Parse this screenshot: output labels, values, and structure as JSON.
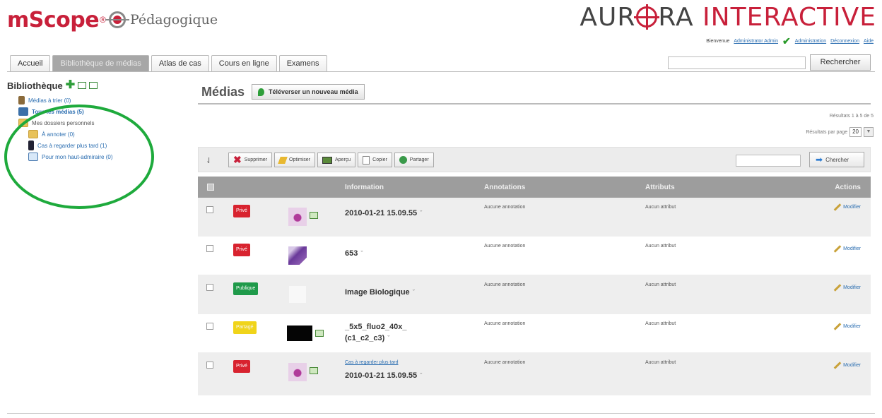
{
  "branding": {
    "mscope": "mScope",
    "reg": "®",
    "pedagogique": "Pédagogique",
    "aurora_a": "AUR",
    "aurora_b": "RA",
    "interactive": "INTERACTIVE",
    "accent_color": "#c8203a"
  },
  "userbar": {
    "welcome": "Bienvenue",
    "user_link": "Administrator Admin",
    "admin_link": "Administration",
    "logout_link": "Déconnexion",
    "help_link": "Aide"
  },
  "tabs": [
    {
      "label": "Accueil"
    },
    {
      "label": "Bibliothèque de médias",
      "active": true
    },
    {
      "label": "Atlas de cas"
    },
    {
      "label": "Cours en ligne"
    },
    {
      "label": "Examens"
    }
  ],
  "top_search": {
    "button": "Rechercher",
    "value": ""
  },
  "sidebar": {
    "title": "Bibliothèque",
    "items": [
      {
        "label": "Médias à trier (0)",
        "icon": "trash-icon"
      },
      {
        "label": "Tous les médias (5)",
        "icon": "book-icon"
      },
      {
        "label": "Mes dossiers personnels",
        "icon": "folder-icon"
      },
      {
        "label": "À annoter (0)",
        "icon": "folder-icon"
      },
      {
        "label": "Cas à regarder plus tard (1)",
        "icon": "person-icon"
      },
      {
        "label": "Pour mon haut-admiraire (0)",
        "icon": "presentation-icon"
      }
    ]
  },
  "main": {
    "title": "Médias",
    "upload_button": "Téléverser un nouveau média",
    "results": "Résultats 1 à 5 de 5",
    "per_page_label": "Résultats par page",
    "per_page_value": "20"
  },
  "toolbar": {
    "delete": "Supprimer",
    "optimize": "Optimiser",
    "preview": "Aperçu",
    "copy": "Copier",
    "share": "Partager",
    "search_button": "Chercher"
  },
  "table": {
    "headers": {
      "information": "Information",
      "annotations": "Annotations",
      "attributes": "Attributs",
      "actions": "Actions"
    },
    "rows": [
      {
        "badge": "Privé",
        "badge_type": "prive",
        "thumb": "pink",
        "info": "2010-01-21 15.09.55",
        "annotations": "Aucune annotation",
        "attributes": "Aucun attribut",
        "action": "Modifier"
      },
      {
        "badge": "Privé",
        "badge_type": "prive",
        "thumb": "purple",
        "info": "653",
        "annotations": "Aucune annotation",
        "attributes": "Aucun attribut",
        "action": "Modifier"
      },
      {
        "badge": "Publique",
        "badge_type": "publique",
        "thumb": "white",
        "info": "Image Biologique",
        "annotations": "Aucune annotation",
        "attributes": "Aucun attribut",
        "action": "Modifier"
      },
      {
        "badge": "Partagé",
        "badge_type": "partage",
        "thumb": "black",
        "info": "_5x5_fluo2_40x_",
        "info2": "(c1_c2_c3)",
        "annotations": "Aucune annotation",
        "attributes": "Aucun attribut",
        "action": "Modifier"
      },
      {
        "badge": "Privé",
        "badge_type": "prive",
        "thumb": "pink",
        "sub": "Cas à regarder plus tard",
        "info": "2010-01-21 15.09.55",
        "annotations": "Aucune annotation",
        "attributes": "Aucun attribut",
        "action": "Modifier"
      }
    ]
  }
}
